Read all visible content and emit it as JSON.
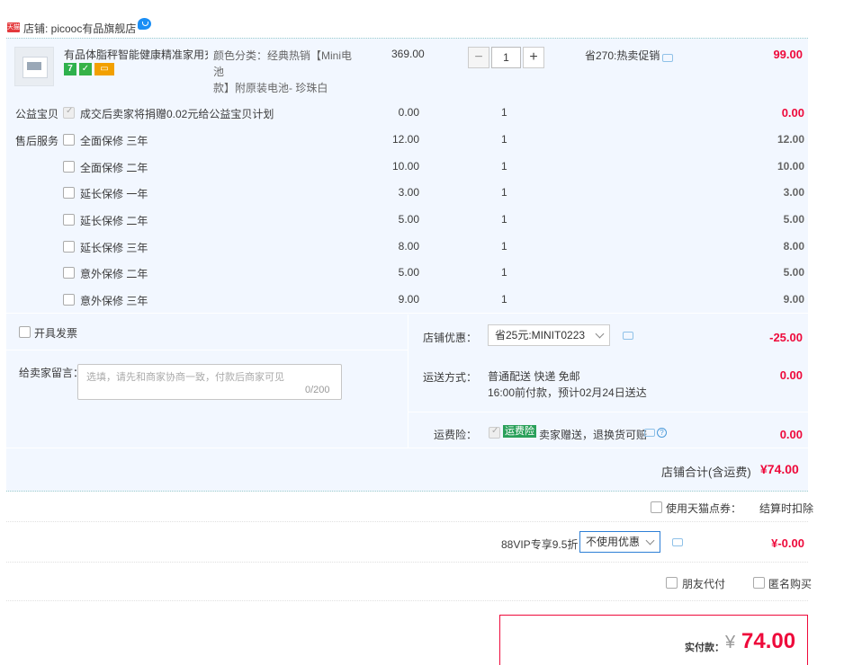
{
  "shop": {
    "badge": "天猫",
    "name": "店铺: picooc有品旗舰店",
    "wangwang_icon": "wangwang-chat-icon"
  },
  "product": {
    "title": "有品体脂秤智能健康精准家用充...",
    "tags": [
      "7",
      "✓",
      "▭"
    ],
    "sku_line1": "颜色分类：经典热销【Mini电池",
    "sku_line2": "款】附原装电池- 珍珠白",
    "price": "369.00",
    "quantity": "1",
    "minus_label": "−",
    "plus_label": "+",
    "promo": "省270:热卖促销",
    "total": "99.00"
  },
  "charity": {
    "label": "公益宝贝",
    "text": "成交后卖家将捐赠0.02元给公益宝贝计划",
    "price": "0.00",
    "qty": "1",
    "total": "0.00"
  },
  "after_sales": {
    "label": "售后服务",
    "items": [
      {
        "name": "全面保修 三年",
        "price": "12.00",
        "qty": "1",
        "total": "12.00"
      },
      {
        "name": "全面保修 二年",
        "price": "10.00",
        "qty": "1",
        "total": "10.00"
      },
      {
        "name": "延长保修 一年",
        "price": "3.00",
        "qty": "1",
        "total": "3.00"
      },
      {
        "name": "延长保修 二年",
        "price": "5.00",
        "qty": "1",
        "total": "5.00"
      },
      {
        "name": "延长保修 三年",
        "price": "8.00",
        "qty": "1",
        "total": "8.00"
      },
      {
        "name": "意外保修 二年",
        "price": "5.00",
        "qty": "1",
        "total": "5.00"
      },
      {
        "name": "意外保修 三年",
        "price": "9.00",
        "qty": "1",
        "total": "9.00"
      }
    ]
  },
  "invoice": {
    "label": "开具发票"
  },
  "message": {
    "label": "给卖家留言：",
    "placeholder": "选填，请先和商家协商一致，付款后商家可见",
    "count": "0/200"
  },
  "coupon": {
    "label": "店铺优惠：",
    "selected": "省25元:MINIT0223",
    "value": "-25.00"
  },
  "shipping": {
    "label": "运送方式：",
    "line1": "普通配送 快递 免邮",
    "line2": "16:00前付款，预计02月24日送达",
    "value": "0.00"
  },
  "freight_insurance": {
    "label": "运费险：",
    "badge": "运费险",
    "text": "卖家赠送，退换货可赔",
    "value": "0.00"
  },
  "shop_total": {
    "label": "店铺合计(含运费)",
    "value": "¥74.00"
  },
  "tmall_points": {
    "label": "使用天猫点券：",
    "note": "结算时扣除"
  },
  "vip": {
    "label": "88VIP专享9.5折",
    "selected": "不使用优惠",
    "value": "¥-0.00"
  },
  "options": {
    "friend_pay": "朋友代付",
    "anonymous": "匿名购买"
  },
  "payment": {
    "label": "实付款：",
    "currency": "¥",
    "value": "74.00"
  },
  "colors": {
    "accent_red": "#ee0a3b",
    "block_bg": "#f2f7ff",
    "link_blue": "#2d7fd6"
  }
}
